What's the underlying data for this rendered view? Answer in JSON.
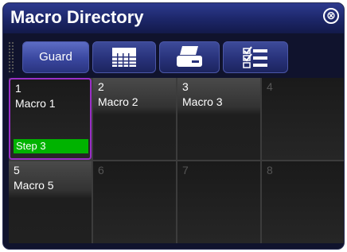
{
  "window": {
    "title": "Macro Directory",
    "close_icon": "⊗"
  },
  "toolbar": {
    "grip_icon": "grip-icon",
    "buttons": [
      {
        "label": "Guard",
        "icon": null
      },
      {
        "label": "",
        "icon": "spreadsheet-grid-icon"
      },
      {
        "label": "",
        "icon": "printer-icon"
      },
      {
        "label": "",
        "icon": "checklist-icon"
      }
    ]
  },
  "macros": [
    {
      "number": "1",
      "name": "Macro 1",
      "step": "Step 3",
      "state": "selected"
    },
    {
      "number": "2",
      "name": "Macro 2",
      "step": "",
      "state": "filled"
    },
    {
      "number": "3",
      "name": "Macro 3",
      "step": "",
      "state": "filled"
    },
    {
      "number": "4",
      "name": "",
      "step": "",
      "state": "empty"
    },
    {
      "number": "5",
      "name": "Macro 5",
      "step": "",
      "state": "filled"
    },
    {
      "number": "6",
      "name": "",
      "step": "",
      "state": "empty"
    },
    {
      "number": "7",
      "name": "",
      "step": "",
      "state": "empty"
    },
    {
      "number": "8",
      "name": "",
      "step": "",
      "state": "empty"
    }
  ],
  "colors": {
    "title_bar": "#1c2668",
    "selection_border": "#9a2fc7",
    "step_bar": "#00b300"
  }
}
